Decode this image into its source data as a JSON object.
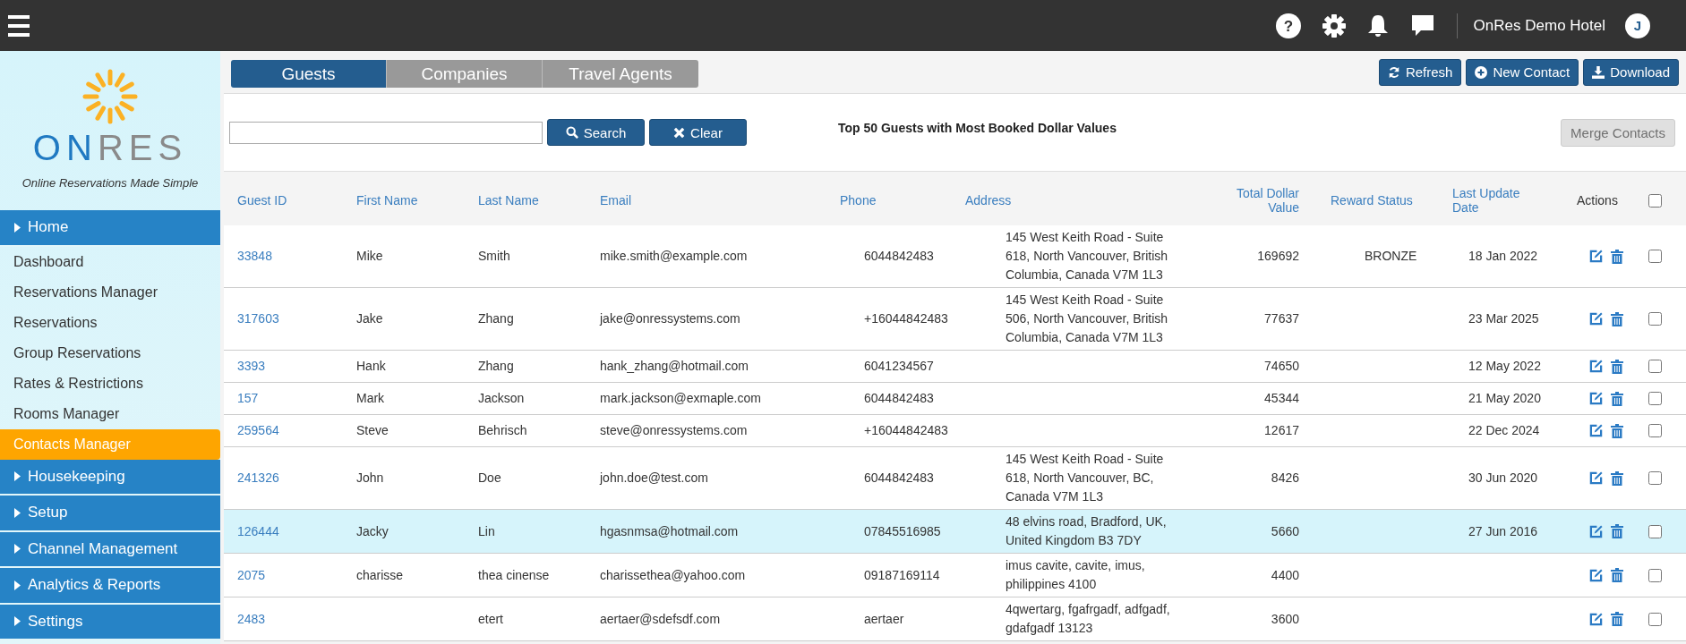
{
  "top_bar": {
    "help_glyph": "?",
    "hotel_name": "OnRes Demo Hotel",
    "avatar_initial": "J"
  },
  "sidebar": {
    "logo_text": "ONRES",
    "tagline": "Online Reservations Made Simple",
    "sections": [
      {
        "label": "Home",
        "children": [
          {
            "label": "Dashboard",
            "selected": false
          },
          {
            "label": "Reservations Manager",
            "selected": false
          },
          {
            "label": "Reservations",
            "selected": false
          },
          {
            "label": "Group Reservations",
            "selected": false
          },
          {
            "label": "Rates & Restrictions",
            "selected": false
          },
          {
            "label": "Rooms Manager",
            "selected": false
          },
          {
            "label": "Contacts Manager",
            "selected": true
          }
        ]
      },
      {
        "label": "Housekeeping"
      },
      {
        "label": "Setup"
      },
      {
        "label": "Channel Management"
      },
      {
        "label": "Analytics & Reports"
      },
      {
        "label": "Settings"
      }
    ]
  },
  "tabs": [
    {
      "label": "Guests",
      "selected": true
    },
    {
      "label": "Companies",
      "selected": false
    },
    {
      "label": "Travel Agents",
      "selected": false
    }
  ],
  "toolbar_buttons": [
    {
      "kind": "refresh",
      "label": "Refresh"
    },
    {
      "kind": "new",
      "label": "New Contact"
    },
    {
      "kind": "download",
      "label": "Download"
    }
  ],
  "search": {
    "search_button": "Search",
    "clear_button": "Clear"
  },
  "caption": "Top 50 Guests with Most Booked Dollar Values",
  "merge_button": {
    "label": "Merge Contacts",
    "disabled": true
  },
  "table": {
    "columns": [
      "Guest ID",
      "First Name",
      "Last Name",
      "Email",
      "Phone",
      "Address",
      "Total Dollar Value",
      "Reward Status",
      "Last Update Date",
      "Actions"
    ],
    "select_all_checked": false,
    "rows": [
      {
        "id": "33848",
        "first": "Mike",
        "last": "Smith",
        "email": "mike.smith@example.com",
        "phone": "6044842483",
        "address": "145 West Keith Road - Suite 618, North Vancouver, British Columbia, Canada V7M 1L3",
        "total": "169692",
        "reward": "BRONZE",
        "date": "18 Jan 2022",
        "selected": false,
        "checked": false
      },
      {
        "id": "317603",
        "first": "Jake",
        "last": "Zhang",
        "email": "jake@onressystems.com",
        "phone": "+16044842483",
        "address": "145 West Keith Road - Suite 506, North Vancouver, British Columbia, Canada V7M 1L3",
        "total": "77637",
        "date": "23 Mar 2025",
        "selected": false,
        "checked": false
      },
      {
        "id": "3393",
        "first": "Hank",
        "last": "Zhang",
        "email": "hank_zhang@hotmail.com",
        "phone": "6041234567",
        "total": "74650",
        "date": "12 May 2022",
        "selected": false,
        "checked": false
      },
      {
        "id": "157",
        "first": "Mark",
        "last": "Jackson",
        "email": "mark.jackson@exmaple.com",
        "phone": "6044842483",
        "total": "45344",
        "date": "21 May 2020",
        "selected": false,
        "checked": false
      },
      {
        "id": "259564",
        "first": "Steve",
        "last": "Behrisch",
        "email": "steve@onressystems.com",
        "phone": "+16044842483",
        "total": "12617",
        "date": "22 Dec 2024",
        "selected": false,
        "checked": false
      },
      {
        "id": "241326",
        "first": "John",
        "last": "Doe",
        "email": "john.doe@test.com",
        "phone": "6044842483",
        "address": "145 West Keith Road - Suite 618, North Vancouver, BC, Canada V7M 1L3",
        "total": "8426",
        "date": "30 Jun 2020",
        "selected": false,
        "checked": false
      },
      {
        "id": "126444",
        "first": "Jacky",
        "last": "Lin",
        "email": "hgasnmsa@hotmail.com",
        "phone": "07845516985",
        "address": "48 elvins road, Bradford, UK, United Kingdom B3 7DY",
        "total": "5660",
        "date": "27 Jun 2016",
        "selected": true,
        "checked": false
      },
      {
        "id": "2075",
        "first": "charisse",
        "last": "thea cinense",
        "email": "charissethea@yahoo.com",
        "phone": "09187169114",
        "address": "imus cavite, cavite, imus, philippines 4100",
        "total": "4400",
        "selected": false,
        "checked": false
      },
      {
        "id": "2483",
        "last": "etert",
        "email": "aertaer@sdefsdf.com",
        "phone": "aertaer",
        "address": "4qwertarg, fgafrgadf, adfgadf, gdafgadf 13123",
        "total": "3600",
        "selected": false,
        "checked": false
      }
    ]
  }
}
